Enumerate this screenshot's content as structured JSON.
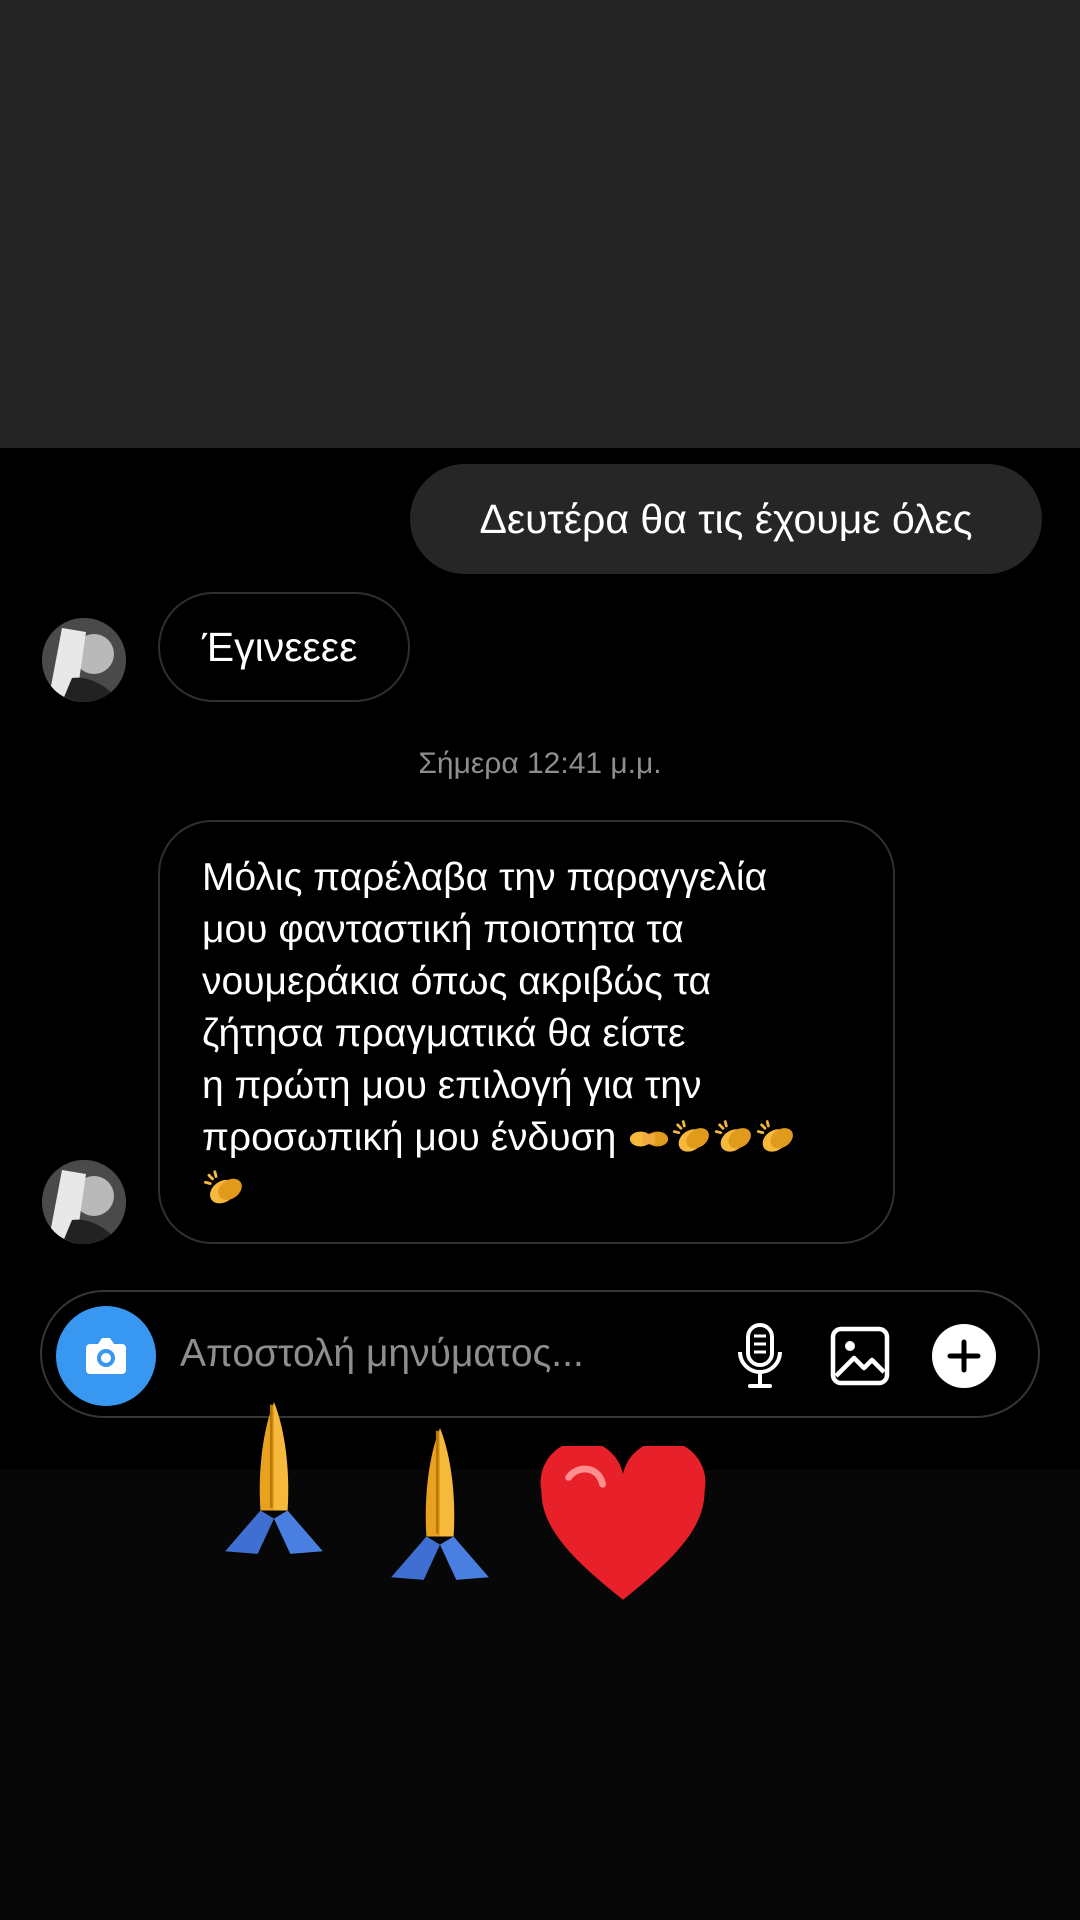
{
  "conversation": {
    "messages": [
      {
        "direction": "outgoing",
        "text": "Δευτέρα θα τις έχουμε όλες"
      },
      {
        "direction": "incoming",
        "text": "Έγινεεεε"
      }
    ],
    "timestamp": "Σήμερα 12:41 μ.μ.",
    "last_message": {
      "direction": "incoming",
      "lines": [
        "Μόλις παρέλαβα την παραγγελία",
        "μου φανταστική ποιοτητα τα",
        "νουμεράκια όπως ακριβώς τα",
        "ζήτησα πραγματικά θα είστε",
        "η πρώτη μου επιλογή για την",
        "προσωπική μου ένδυση"
      ],
      "emojis": [
        "handshake-emoji",
        "clapping-hands-emoji",
        "clapping-hands-emoji",
        "clapping-hands-emoji",
        "clapping-hands-emoji"
      ]
    }
  },
  "composer": {
    "placeholder": "Αποστολή μηνύματος...",
    "icons": [
      "camera-icon",
      "microphone-icon",
      "gallery-icon",
      "plus-icon"
    ]
  },
  "sticker_emojis": [
    "folded-hands-emoji",
    "folded-hands-emoji",
    "red-heart-emoji"
  ],
  "colors": {
    "top_background": "#252525",
    "chat_background": "#000000",
    "outgoing_bubble": "#262626",
    "incoming_bubble_border": "#2f2f2f",
    "camera_button": "#3897f0",
    "timestamp_text": "#8e8e8e"
  }
}
